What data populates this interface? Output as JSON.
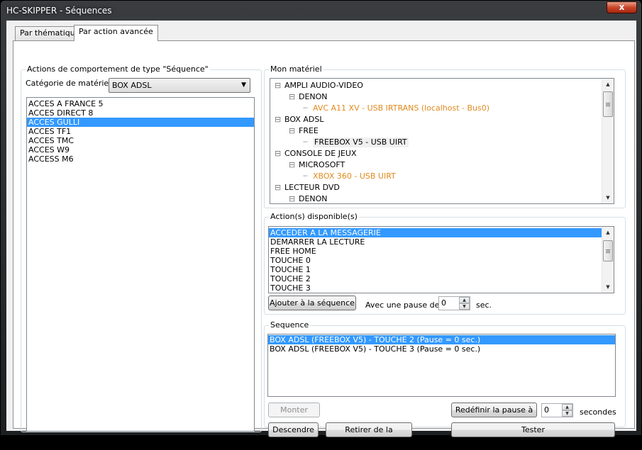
{
  "window": {
    "title": "HC-SKIPPER - Séquences",
    "close_label": "x"
  },
  "tabs": [
    {
      "label": "Par thématique",
      "active": false
    },
    {
      "label": "Par action avancée",
      "active": true
    }
  ],
  "left_group": {
    "label": "Actions de comportement de type \"Séquence\"",
    "category_label": "Catégorie de matériel :",
    "category_value": "BOX ADSL",
    "items": [
      {
        "label": "ACCES A FRANCE 5",
        "selected": false
      },
      {
        "label": "ACCES DIRECT 8",
        "selected": false
      },
      {
        "label": "ACCES GULLI",
        "selected": true
      },
      {
        "label": "ACCES TF1",
        "selected": false
      },
      {
        "label": "ACCES TMC",
        "selected": false
      },
      {
        "label": "ACCES W9",
        "selected": false
      },
      {
        "label": "ACCESS M6",
        "selected": false
      }
    ]
  },
  "materiel": {
    "label": "Mon matériel",
    "tree": [
      {
        "label": "AMPLI AUDIO-VIDEO",
        "level": 0,
        "kind": "node"
      },
      {
        "label": "DENON",
        "level": 1,
        "kind": "node"
      },
      {
        "label": "AVC A11 XV - USB IRTRANS (localhost - Bus0)",
        "level": 2,
        "kind": "leaf"
      },
      {
        "label": "BOX ADSL",
        "level": 0,
        "kind": "node"
      },
      {
        "label": "FREE",
        "level": 1,
        "kind": "node"
      },
      {
        "label": "FREEBOX V5 - USB UIRT",
        "level": 2,
        "kind": "selleaf"
      },
      {
        "label": "CONSOLE DE JEUX",
        "level": 0,
        "kind": "node"
      },
      {
        "label": "MICROSOFT",
        "level": 1,
        "kind": "node"
      },
      {
        "label": "XBOX 360 - USB UIRT",
        "level": 2,
        "kind": "leaf"
      },
      {
        "label": "LECTEUR DVD",
        "level": 0,
        "kind": "node"
      },
      {
        "label": "DENON",
        "level": 1,
        "kind": "node"
      }
    ]
  },
  "actions": {
    "label": "Action(s) disponible(s)",
    "items": [
      {
        "label": "ACCEDER A LA MESSAGERIE",
        "selected": true
      },
      {
        "label": "DEMARRER LA LECTURE",
        "selected": false
      },
      {
        "label": "FREE HOME",
        "selected": false
      },
      {
        "label": "TOUCHE 0",
        "selected": false
      },
      {
        "label": "TOUCHE 1",
        "selected": false
      },
      {
        "label": "TOUCHE 2",
        "selected": false
      },
      {
        "label": "TOUCHE 3",
        "selected": false
      }
    ],
    "add_button": "Ajouter à la séquence",
    "pause_label": "Avec une pause de",
    "pause_value": "0",
    "sec_label": "sec."
  },
  "sequence": {
    "label": "Sequence",
    "items": [
      {
        "label": "BOX ADSL (FREEBOX V5) - TOUCHE 2 (Pause = 0 sec.)",
        "selected": true
      },
      {
        "label": "BOX ADSL (FREEBOX V5) - TOUCHE 3 (Pause = 0 sec.)",
        "selected": false
      }
    ],
    "monter": "Monter",
    "descendre": "Descendre",
    "retirer": "Retirer de la séquence",
    "redefinir": "Redéfinir la pause à",
    "redefinir_value": "0",
    "secondes_label": "secondes",
    "tester": "Tester"
  }
}
